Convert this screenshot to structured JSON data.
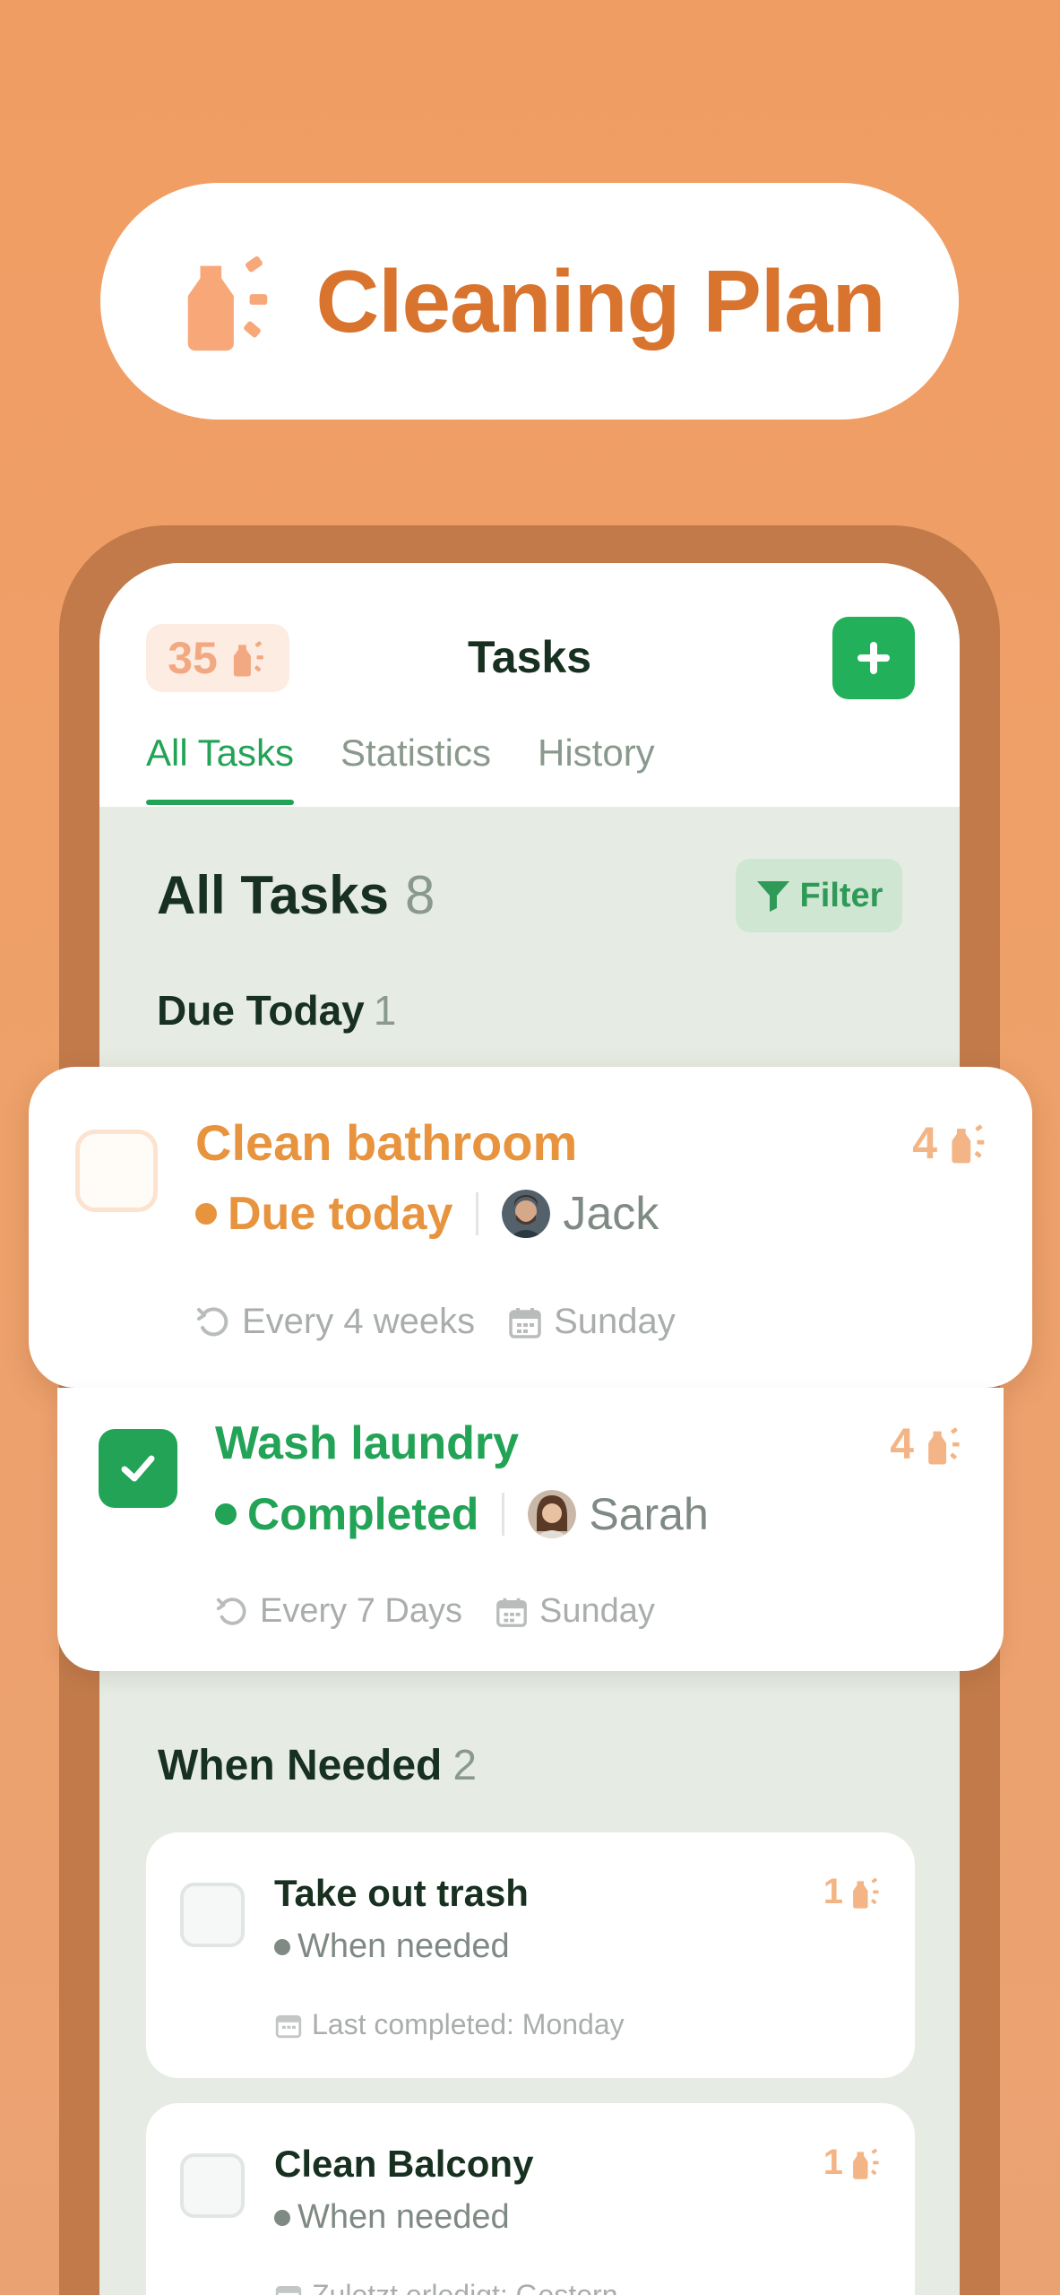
{
  "app": {
    "title": "Cleaning Plan"
  },
  "header": {
    "points": "35",
    "title": "Tasks",
    "add_icon": "plus-icon"
  },
  "tabs": [
    {
      "label": "All Tasks",
      "active": true
    },
    {
      "label": "Statistics",
      "active": false
    },
    {
      "label": "History",
      "active": false
    }
  ],
  "all_tasks": {
    "heading": "All Tasks",
    "count": "8",
    "filter_label": "Filter"
  },
  "due_today": {
    "heading": "Due Today",
    "count": "1"
  },
  "tasks": [
    {
      "title": "Clean bathroom",
      "points": "4",
      "status": "Due today",
      "status_color": "#e8933d",
      "assignee": "Jack",
      "recurrence": "Every 4 weeks",
      "day": "Sunday",
      "checked": false
    },
    {
      "title": "Wash laundry",
      "points": "4",
      "status": "Completed",
      "status_color": "#22a356",
      "assignee": "Sarah",
      "recurrence": "Every 7 Days",
      "day": "Sunday",
      "checked": true
    }
  ],
  "when_needed": {
    "heading": "When Needed",
    "count": "2",
    "items": [
      {
        "title": "Take out trash",
        "points": "1",
        "status": "When needed",
        "meta": "Last completed: Monday"
      },
      {
        "title": "Clean Balcony",
        "points": "1",
        "status": "When needed",
        "meta": "Zuletzt erledigt: Gestern"
      }
    ]
  },
  "colors": {
    "accent_green": "#22a356",
    "accent_orange": "#d9742f",
    "background": "#f09d63"
  }
}
